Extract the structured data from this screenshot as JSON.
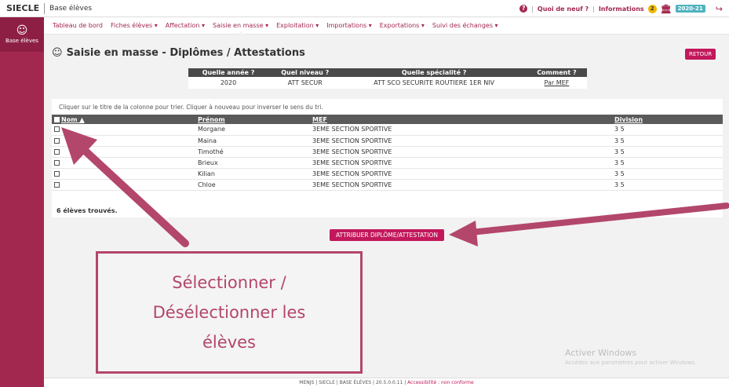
{
  "header": {
    "brand": "SIECLE",
    "app": "Base élèves",
    "whats_new": "Quoi de neuf ?",
    "informations": "Informations",
    "info_count": "2",
    "year": "2020-21",
    "help_icon": "?",
    "sep": "|"
  },
  "sidebar": {
    "label": "Base élèves",
    "icon": "users-icon"
  },
  "nav": {
    "items": [
      "Tableau de bord",
      "Fiches élèves ▾",
      "Affectation ▾",
      "Saisie en masse ▾",
      "Exploitation ▾",
      "Importations ▾",
      "Exportations ▾",
      "Suivi des échanges ▾"
    ]
  },
  "page": {
    "title": "Saisie en masse - Diplômes / Attestations",
    "retour": "RETOUR"
  },
  "criteria": {
    "headers": [
      "Quelle année ?",
      "Quel niveau ?",
      "Quelle spécialité ?",
      "Comment ?"
    ],
    "values": [
      "2020",
      "ATT SECUR",
      "ATT SCO SECURITE ROUTIERE 1ER NIV",
      "Par MEF"
    ]
  },
  "table": {
    "hint": "Cliquer sur le titre de la colonne pour trier. Cliquer à nouveau pour inverser le sens du tri.",
    "columns": [
      "Nom ▲",
      "Prénom",
      "MEF",
      "Division"
    ],
    "rows": [
      [
        "",
        "Morgane",
        "3EME SECTION SPORTIVE",
        "3 5"
      ],
      [
        "",
        "Maina",
        "3EME SECTION SPORTIVE",
        "3 5"
      ],
      [
        "",
        "Timothé",
        "3EME SECTION SPORTIVE",
        "3 5"
      ],
      [
        "",
        "Brieux",
        "3EME SECTION SPORTIVE",
        "3 5"
      ],
      [
        "",
        "Kilian",
        "3EME SECTION SPORTIVE",
        "3 5"
      ],
      [
        "",
        "Chloe",
        "3EME SECTION SPORTIVE",
        "3 5"
      ]
    ],
    "count": "6 élèves trouvés."
  },
  "action": {
    "assign": "ATTRIBUER DIPLÔME/ATTESTATION"
  },
  "callout": {
    "lines": [
      "Sélectionner /",
      "Désélectionner les",
      "élèves"
    ]
  },
  "watermark": {
    "title": "Activer Windows",
    "sub": "Accédez aux paramètres pour activer Windows."
  },
  "footer": {
    "items": [
      "MENJS",
      "SIECLE",
      "BASE ÉLÈVES",
      "20.5.0.0.11"
    ],
    "accessibility": "Accessibilité : non conforme"
  },
  "colors": {
    "accent": "#a3284f",
    "button": "#c2185b",
    "callout": "#b3466b"
  }
}
